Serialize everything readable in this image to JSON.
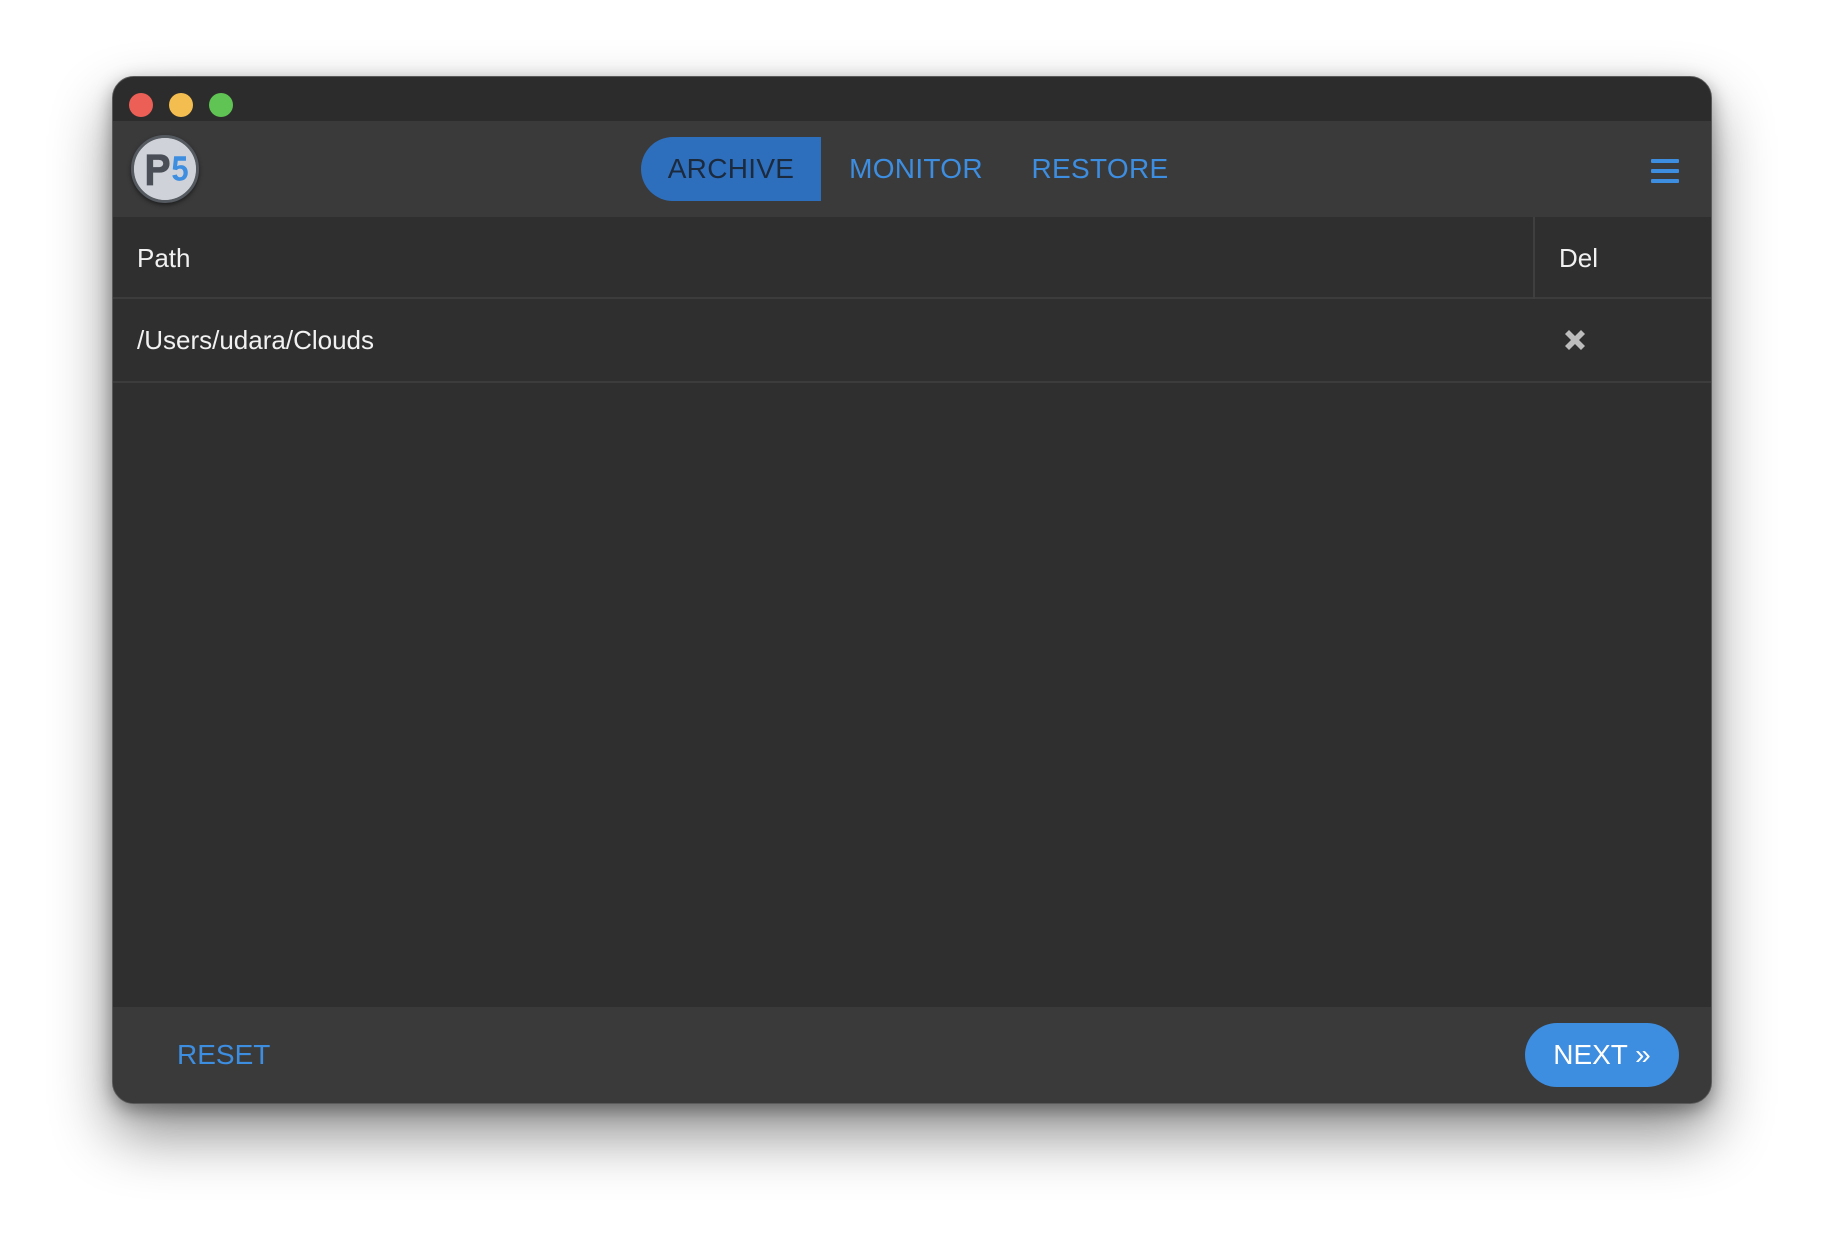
{
  "window": {
    "controls": [
      "close",
      "minimize",
      "maximize"
    ]
  },
  "navbar": {
    "logo_icon": "p5-logo-icon",
    "tabs": [
      {
        "label": "ARCHIVE",
        "active": true
      },
      {
        "label": "MONITOR",
        "active": false
      },
      {
        "label": "RESTORE",
        "active": false
      }
    ],
    "menu_icon": "hamburger-menu-icon"
  },
  "table": {
    "columns": [
      "Path",
      "Del"
    ],
    "rows": [
      {
        "path": "/Users/udara/Clouds",
        "delete_icon": "close-x-icon"
      }
    ]
  },
  "footer": {
    "reset_label": "RESET",
    "next_label": "NEXT »"
  },
  "colors": {
    "accent": "#3d8de0",
    "active_tab_bg": "#2e6fbd",
    "window_bg": "#2f2f2f",
    "bar_bg": "#3a3a3a"
  }
}
